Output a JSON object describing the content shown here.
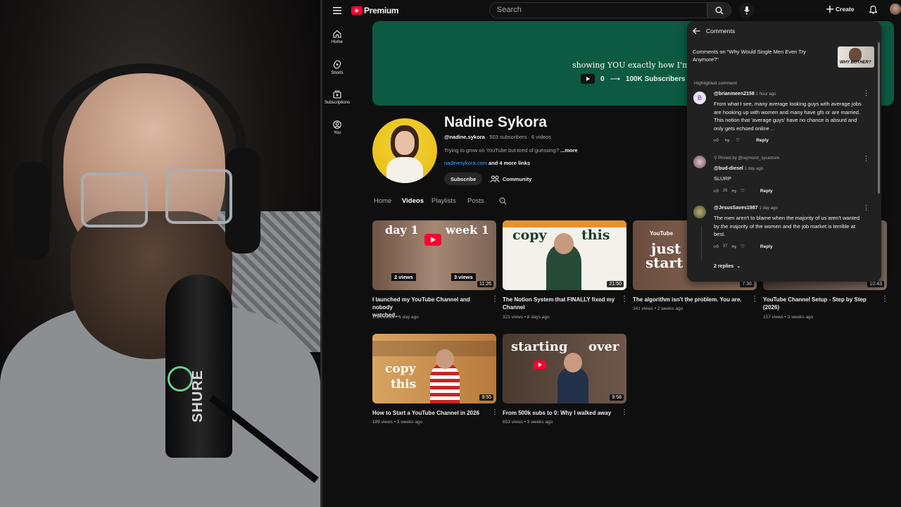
{
  "header": {
    "logo_text": "Premium",
    "search_placeholder": "Search",
    "create_label": "Create"
  },
  "sidebar": {
    "items": [
      {
        "label": "Home",
        "icon": "home-icon"
      },
      {
        "label": "Shorts",
        "icon": "shorts-icon"
      },
      {
        "label": "Subscriptions",
        "icon": "subscriptions-icon"
      },
      {
        "label": "You",
        "icon": "you-icon"
      }
    ]
  },
  "banner": {
    "tagline": "showing YOU exactly how I'm growing",
    "start_count": "0",
    "goal": "100K Subscribers"
  },
  "channel": {
    "name": "Nadine Sykora",
    "handle": "@nadine.sykora",
    "stats": "· 503 subscribers · 6 videos",
    "description": "Trying to grow on YouTube but tired of guessing?",
    "more": "...more",
    "link": "nadinesykora.com",
    "more_links": "and 4 more links",
    "subscribe_label": "Subscribe",
    "community_label": "Community"
  },
  "tabs": [
    "Home",
    "Videos",
    "Playlists",
    "Posts"
  ],
  "videos": [
    {
      "title_line1": "I launched my YouTube Channel and nobody",
      "title_line2": "watched...",
      "meta": "1.1K views • 1 day ago",
      "duration": "11:26",
      "thumb_text_a": "day 1",
      "thumb_text_b": "week 1",
      "badge_a": "2 views",
      "badge_b": "3 views"
    },
    {
      "title_line1": "The Notion System that FINALLY fixed my",
      "title_line2": "Channel",
      "meta": "321 views • 8 days ago",
      "duration": "21:50",
      "thumb_text_a": "copy",
      "thumb_text_b": "this"
    },
    {
      "title_line1": "The algorithm isn't the problem. You are.",
      "title_line2": "",
      "meta": "341 views • 2 weeks ago",
      "duration": "7:36",
      "thumb_text_a": "just",
      "thumb_text_b": "start",
      "thumb_brand": "YouTube"
    },
    {
      "title_line1": "YouTube Channel Setup - Step by Step",
      "title_line2": "(2026)",
      "meta": "157 views • 3 weeks ago",
      "duration": "10:43"
    },
    {
      "title_line1": "How to Start a YouTube Channel in 2026",
      "title_line2": "",
      "meta": "189 views • 3 weeks ago",
      "duration": "9:55",
      "thumb_text_a": "copy",
      "thumb_text_b": "this"
    },
    {
      "title_line1": "From 500k subs to 0: Why I walked away",
      "title_line2": "",
      "meta": "853 views • 3 weeks ago",
      "duration": "9:58",
      "thumb_text_a": "starting",
      "thumb_text_b": "over"
    }
  ],
  "comments_panel": {
    "title": "Comments",
    "video_line1": "Comments on \"Why Would Single Men Even Try",
    "video_line2": "Anymore?\"",
    "video_thumb_text": "WHY BOTHER?",
    "highlighted_label": "Highlighted comment",
    "comments": [
      {
        "avatar_letter": "B",
        "author": "@brianmeen2158",
        "time": "1 hour ago",
        "lines": [
          "From what I see, many average looking guys with average jobs",
          "are hooking up with women and many have gfs or are married.",
          "This notion that 'average guys' have no chance is absurd and",
          "only gets echoed online .."
        ],
        "likes": "",
        "reply": "Reply"
      },
      {
        "pinned": "Pinned by @raymond_sycamore",
        "author": "@bud-diesel",
        "time": "1 day ago",
        "lines": [
          "SLURP"
        ],
        "likes": "26",
        "reply": "Reply"
      },
      {
        "author": "@JesusSaves1987",
        "time": "1 day ago",
        "lines": [
          "The men aren't to blame when the majority of us aren't wanted",
          "by the majority of the women and the job market is terrible at",
          "best."
        ],
        "likes": "37",
        "reply": "Reply",
        "replies": "2 replies"
      }
    ]
  },
  "webcam": {
    "mic_brand": "SHURE"
  },
  "colors": {
    "brand_red": "#ff0033",
    "banner_green": "#0b5a41",
    "link_blue": "#3ea6ff",
    "panel_bg": "#212121"
  }
}
